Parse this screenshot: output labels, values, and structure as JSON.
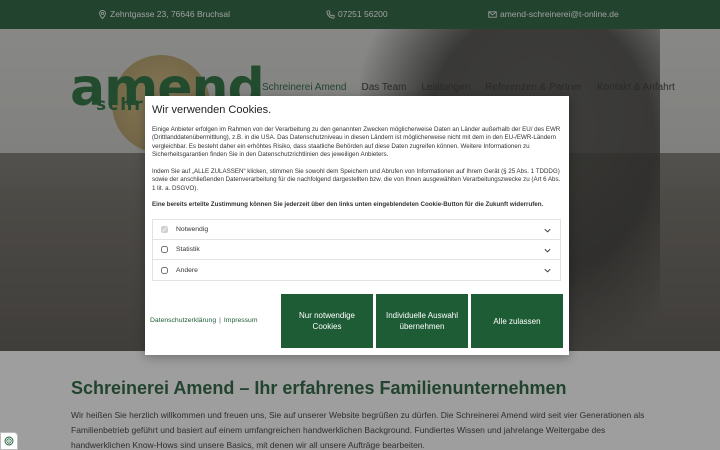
{
  "topbar": {
    "address": "Zehntgasse 23, 76646 Bruchsal",
    "phone": "07251 56200",
    "email": "amend-schreinerei@t-online.de"
  },
  "logo": {
    "main": "amend",
    "sub": "schreinerei"
  },
  "nav": {
    "items": [
      "Schreinerei Amend",
      "Das Team",
      "Leistungen",
      "Referenzen & Partner",
      "Kontakt & Anfahrt"
    ]
  },
  "content": {
    "title": "Schreinerei Amend – Ihr erfahrenes Familienunternehmen",
    "text": "Wir heißen Sie herzlich willkommen und freuen uns, Sie auf unserer Website begrüßen zu dürfen. Die Schreinerei Amend wird seit vier Generationen als Familienbetrieb geführt und basiert auf einem umfangreichen handwerklichen Background. Fundiertes Wissen und jahrelange Weitergabe des handwerklichen Know-Hows sind unsere Basics, mit denen wir all unsere Aufträge bearbeiten."
  },
  "cookie": {
    "title": "Wir verwenden Cookies.",
    "para1": "Einige Anbieter erfolgen im Rahmen von der Verarbeitung zu den genannten Zwecken möglicherweise Daten an Länder außerhalb der EU/ des EWR (Drittlanddatenübermittlung), z.B. in die USA. Das Datenschutzniveau in diesen Ländern ist möglicherweise nicht mit dem in den EU-/EWR-Ländern vergleichbar. Es besteht daher ein erhöhtes Risiko, dass staatliche Behörden auf diese Daten zugreifen können. Weitere Informationen zu Sicherheitsgarantien finden Sie in den Datenschutzrichtlinien des jeweiligen Anbieters.",
    "para2": "Indem Sie auf „ALLE ZULASSEN“ klicken, stimmen Sie sowohl dem Speichern und Abrufen von Informationen auf Ihrem Gerät (§ 25 Abs. 1 TDDDG) sowie der anschließenden Datenverarbeitung für die nachfolgend dargestellten bzw. die von Ihnen ausgewählten Verarbeitungszwecke zu (Art 6 Abs. 1 lit. a. DSGVO).",
    "para3": "Eine bereits erteilte Zustimmung können Sie jederzeit über den links unten eingeblendeten Cookie-Button für die Zukunft widerrufen.",
    "categories": [
      {
        "label": "Notwendig",
        "checked": true,
        "disabled": true
      },
      {
        "label": "Statistik",
        "checked": false,
        "disabled": false
      },
      {
        "label": "Andere",
        "checked": false,
        "disabled": false
      }
    ],
    "link_privacy": "Datenschutzerklärung",
    "link_sep": "|",
    "link_imprint": "Impressum",
    "btn_necessary": "Nur notwendige Cookies",
    "btn_individual": "Individuelle Auswahl übernehmen",
    "btn_all": "Alle zulassen"
  },
  "colors": {
    "brand_green": "#1e5c36",
    "overlay": "rgba(40,40,40,0.45)"
  },
  "icons": [
    "map-pin-icon",
    "phone-icon",
    "envelope-icon",
    "chevron-down-icon",
    "fingerprint-icon"
  ]
}
